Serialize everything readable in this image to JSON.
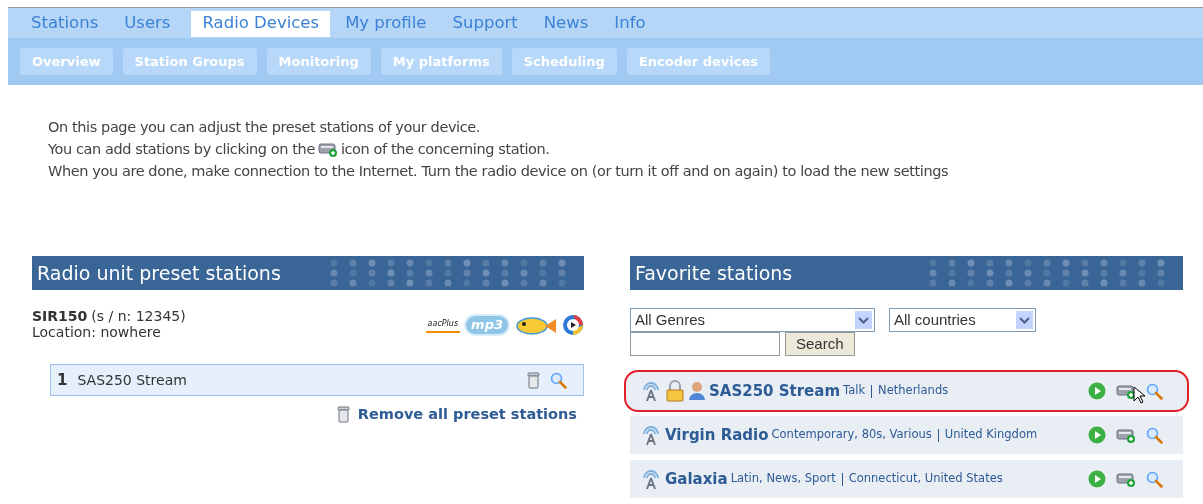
{
  "main_nav": [
    {
      "label": "Stations",
      "selected": false
    },
    {
      "label": "Users",
      "selected": false
    },
    {
      "label": "Radio Devices",
      "selected": true
    },
    {
      "label": "My profile",
      "selected": false
    },
    {
      "label": "Support",
      "selected": false
    },
    {
      "label": "News",
      "selected": false
    },
    {
      "label": "Info",
      "selected": false
    }
  ],
  "sub_nav": [
    "Overview",
    "Station Groups",
    "Monitoring",
    "My platforms",
    "Scheduling",
    "Encoder devices"
  ],
  "intro": {
    "line_1": "On this page you can adjust the preset stations of your device.",
    "line_2_before": "You can add stations by clicking on the",
    "line_2_after": "icon of the concerning station.",
    "line_3": "When you are done, make connection to the Internet. Turn the radio device on (or turn it off and on again) to load the new settings"
  },
  "preset_panel": {
    "title": "Radio unit preset stations",
    "device": "SIR150",
    "serial": "(s / n: 12345)",
    "location": "Location: nowhere",
    "codecs": [
      "aacPlus",
      "mp3"
    ],
    "presets": [
      {
        "number": "1",
        "name": "SAS250 Stream"
      }
    ],
    "remove_all": "Remove all preset stations"
  },
  "favorites_panel": {
    "title": "Favorite stations",
    "genre_select": "All Genres",
    "country_select": "All countries",
    "search_button": "Search",
    "stations": [
      {
        "name": "SAS250 Stream",
        "genres": "Talk",
        "country": "Netherlands",
        "locked": true,
        "user": true,
        "highlighted": true
      },
      {
        "name": "Virgin Radio",
        "genres": "Contemporary, 80s, Various",
        "country": "United Kingdom",
        "locked": false,
        "user": false,
        "highlighted": false
      },
      {
        "name": "Galaxia",
        "genres": "Latin, News, Sport",
        "country": "Connecticut, United States",
        "locked": false,
        "user": false,
        "highlighted": false
      }
    ]
  }
}
